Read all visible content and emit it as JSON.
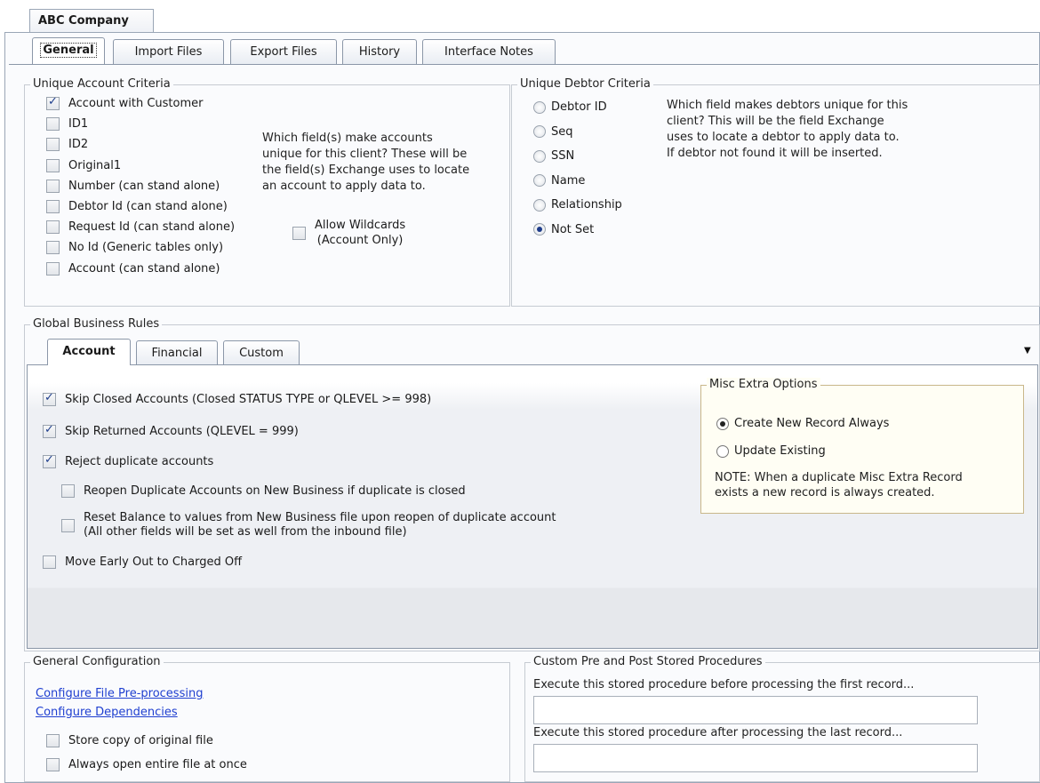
{
  "company_tab": "ABC Company",
  "main_tabs": [
    "General",
    "Import Files",
    "Export Files",
    "History",
    "Interface Notes"
  ],
  "unique_account": {
    "title": "Unique Account Criteria",
    "items": [
      {
        "label": "Account with Customer",
        "checked": true
      },
      {
        "label": "ID1",
        "checked": false
      },
      {
        "label": "ID2",
        "checked": false
      },
      {
        "label": "Original1",
        "checked": false
      },
      {
        "label": "Number (can stand alone)",
        "checked": false
      },
      {
        "label": "Debtor Id (can stand alone)",
        "checked": false
      },
      {
        "label": "Request Id (can stand alone)",
        "checked": false
      },
      {
        "label": "No Id (Generic tables only)",
        "checked": false
      },
      {
        "label": "Account (can stand alone)",
        "checked": false
      }
    ],
    "help_lines": [
      "Which field(s) make accounts",
      "unique for this client?  These will be",
      "the field(s) Exchange uses to locate",
      "an account to apply data to."
    ],
    "wildcards_line1": "Allow Wildcards",
    "wildcards_line2": "(Account Only)"
  },
  "unique_debtor": {
    "title": "Unique Debtor Criteria",
    "options": [
      "Debtor ID",
      "Seq",
      "SSN",
      "Name",
      "Relationship",
      "Not Set"
    ],
    "selected": "Not Set",
    "help_lines": [
      "Which field makes debtors unique for this",
      "client?  This will be the field Exchange",
      "uses to locate a debtor to apply data to.",
      "If debtor not found it will be inserted."
    ]
  },
  "global_rules": {
    "title": "Global Business Rules",
    "tabs": [
      "Account",
      "Financial",
      "Custom"
    ],
    "skip_closed": "Skip Closed Accounts (Closed STATUS TYPE or QLEVEL >= 998)",
    "skip_returned": "Skip Returned Accounts (QLEVEL = 999)",
    "reject_duplicates": "Reject duplicate accounts",
    "reopen_duplicates": "Reopen Duplicate Accounts on New Business if duplicate is closed",
    "reset_balance_1": "Reset Balance to values from New Business file upon reopen of duplicate account",
    "reset_balance_2": "(All other fields will be set as well from the inbound file)",
    "move_early_out": "Move Early Out to Charged Off",
    "misc": {
      "title": "Misc Extra Options",
      "create_new": "Create New Record Always",
      "update_existing": "Update Existing",
      "note_1": "NOTE: When a duplicate Misc Extra Record",
      "note_2": "exists a new record is always created."
    }
  },
  "general_config": {
    "title": "General Configuration",
    "link_preprocessing": "Configure File Pre-processing",
    "link_dependencies": "Configure Dependencies",
    "store_copy": "Store copy of original file",
    "open_entire": "Always open entire file at once"
  },
  "stored_procs": {
    "title": "Custom Pre and Post Stored Procedures",
    "before_label": "Execute this stored procedure before processing the first record...",
    "before_value": "",
    "after_label": "Execute this stored procedure after processing the last record...",
    "after_value": ""
  }
}
